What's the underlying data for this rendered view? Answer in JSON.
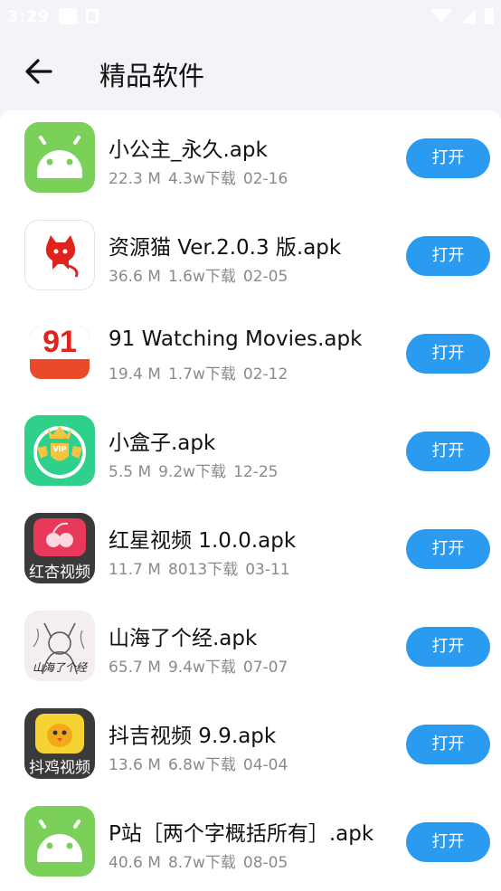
{
  "status_bar": {
    "time": "3:29"
  },
  "header": {
    "title": "精品软件",
    "back_icon": "arrow-left-icon"
  },
  "colors": {
    "accent": "#2b9bf2",
    "android_green": "#7bd05a",
    "meta_grey": "#8a8a8a"
  },
  "apps": [
    {
      "name": "小公主_永久.apk",
      "size": "22.3 M",
      "downloads": "4.3w下载",
      "date": "02-16",
      "button": "打开",
      "icon": "android-icon"
    },
    {
      "name": "资源猫 Ver.2.0.3 版.apk",
      "size": "36.6 M",
      "downloads": "1.6w下载",
      "date": "02-05",
      "button": "打开",
      "icon": "cat-logo-icon"
    },
    {
      "name": "91 Watching Movies.apk",
      "size": "19.4 M",
      "downloads": "1.7w下载",
      "date": "02-12",
      "button": "打开",
      "icon": "91-logo-icon",
      "icon_text": "91"
    },
    {
      "name": "小盒子.apk",
      "size": "5.5 M",
      "downloads": "9.2w下载",
      "date": "12-25",
      "button": "打开",
      "icon": "vip-crown-icon",
      "icon_text": "VIP"
    },
    {
      "name": "红星视频 1.0.0.apk",
      "size": "11.7 M",
      "downloads": "8013下载",
      "date": "03-11",
      "button": "打开",
      "icon": "cherry-icon",
      "icon_text": "红杏视频"
    },
    {
      "name": "山海了个经.apk",
      "size": "65.7 M",
      "downloads": "9.4w下载",
      "date": "07-07",
      "button": "打开",
      "icon": "sketch-girl-icon",
      "icon_text": "山海了个经"
    },
    {
      "name": "抖吉视频 9.9.apk",
      "size": "13.6 M",
      "downloads": "6.8w下载",
      "date": "04-04",
      "button": "打开",
      "icon": "chick-icon",
      "icon_text": "抖鸡视频"
    },
    {
      "name": "P站［两个字概括所有］.apk",
      "size": "40.6 M",
      "downloads": "8.7w下载",
      "date": "08-05",
      "button": "打开",
      "icon": "android-icon"
    }
  ]
}
